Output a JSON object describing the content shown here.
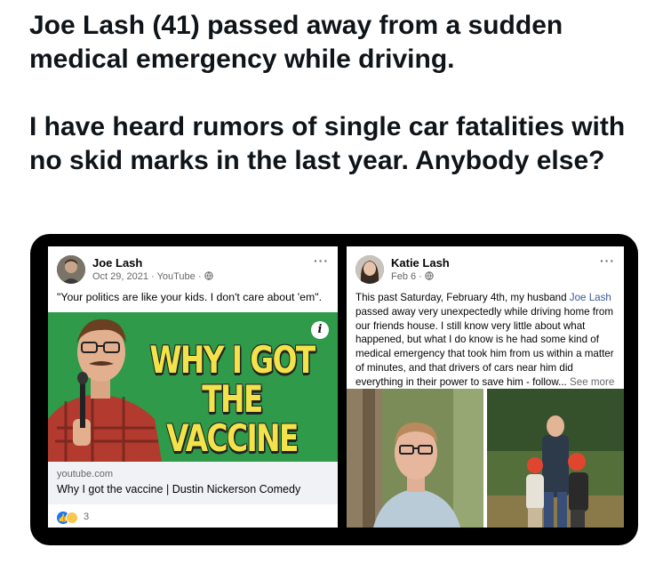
{
  "tweet": {
    "line1": "Joe Lash (41) passed away from a sudden medical emergency while driving.",
    "line2": "I have heard rumors of single car fatalities with no skid marks in the last year. Anybody else?"
  },
  "left_post": {
    "author": "Joe Lash",
    "meta": "Oct 29, 2021 · YouTube · ",
    "caption": "\"Your politics are like your kids. I don't care about 'em\".",
    "thumbnail_text": "WHY I GOT THE VACCINE",
    "info_badge": "i",
    "link_domain": "youtube.com",
    "link_title": "Why I got the vaccine | Dustin Nickerson Comedy",
    "reaction_count": "3"
  },
  "right_post": {
    "author": "Katie Lash",
    "meta": "Feb 6 · ",
    "body_before": "This past Saturday, February 4th, my husband ",
    "mention": "Joe Lash",
    "body_after": " passed away very unexpectedly while driving home from our friends house. I still know very little about what happened, but what I do know is he had some kind of medical emergency that took him from us within a matter of minutes, and that drivers of cars near him did everything in their power to save him - follow... ",
    "see_more": "See more"
  },
  "icons": {
    "more": "more-options-icon",
    "audience": "globe-icon",
    "like": "like-reaction-icon",
    "haha": "haha-reaction-icon"
  },
  "colors": {
    "link_blue": "#385898",
    "like_blue": "#1877f2",
    "thumbnail_green": "#2e9a4a",
    "thumbnail_text": "#f3e34a"
  }
}
